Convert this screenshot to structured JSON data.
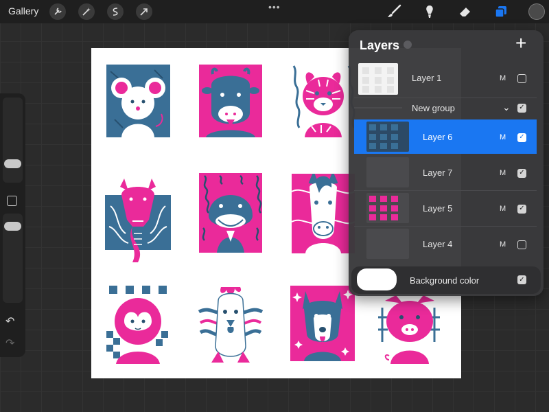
{
  "toolbar": {
    "gallery_label": "Gallery",
    "left_icons": [
      "wrench-icon",
      "magic-wand-icon",
      "selection-icon",
      "transform-arrow-icon"
    ],
    "more_dots": "•••",
    "right_icons": [
      "brush-icon",
      "smudge-icon",
      "eraser-icon",
      "layers-icon"
    ],
    "active_tool": "layers",
    "accent_color": "#1a77f2",
    "current_color": "#4a4a4a"
  },
  "sidebar": {
    "undo_label": "↶",
    "redo_label": "↷"
  },
  "layers_panel": {
    "title": "Layers",
    "add_label": "+",
    "group_chevron": "⌄",
    "layers": [
      {
        "name": "Layer 1",
        "mode": "M",
        "visible": false,
        "selected": false,
        "thumb": "light"
      },
      {
        "name": "New group",
        "mode": "",
        "visible": true,
        "selected": false,
        "thumb": "none"
      },
      {
        "name": "Layer 6",
        "mode": "M",
        "visible": true,
        "selected": true,
        "thumb": "blue"
      },
      {
        "name": "Layer 7",
        "mode": "M",
        "visible": true,
        "selected": false,
        "thumb": "dark"
      },
      {
        "name": "Layer 5",
        "mode": "M",
        "visible": true,
        "selected": false,
        "thumb": "pink"
      },
      {
        "name": "Layer 4",
        "mode": "M",
        "visible": false,
        "selected": false,
        "thumb": "dark"
      }
    ],
    "background": {
      "name": "Background color",
      "visible": true,
      "color": "#ffffff"
    }
  },
  "artwork": {
    "colors": {
      "blue": "#3a6f96",
      "pink": "#ea2a9a",
      "white": "#ffffff"
    },
    "tiles": [
      {
        "animal": "rat",
        "bg": "blue"
      },
      {
        "animal": "ox",
        "bg": "pink"
      },
      {
        "animal": "tiger",
        "bg": "pattern"
      },
      {
        "animal": "dragon",
        "bg": "pink"
      },
      {
        "animal": "snake",
        "bg": "pink"
      },
      {
        "animal": "horse",
        "bg": "pink"
      },
      {
        "animal": "monkey",
        "bg": "pattern"
      },
      {
        "animal": "rooster",
        "bg": "pattern"
      },
      {
        "animal": "dog",
        "bg": "pink"
      },
      {
        "animal": "pig",
        "bg": "blue"
      }
    ]
  }
}
